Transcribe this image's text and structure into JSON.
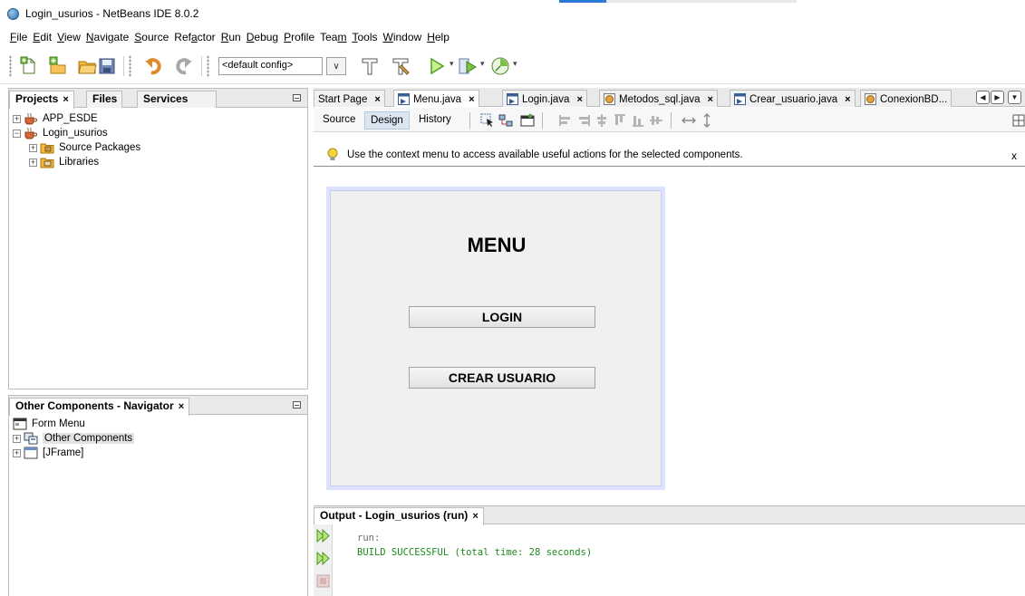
{
  "window": {
    "title": "Login_usurios - NetBeans IDE 8.0.2"
  },
  "menubar": {
    "items": [
      {
        "pre": "",
        "ul": "F",
        "post": "ile"
      },
      {
        "pre": "",
        "ul": "E",
        "post": "dit"
      },
      {
        "pre": "",
        "ul": "V",
        "post": "iew"
      },
      {
        "pre": "",
        "ul": "N",
        "post": "avigate"
      },
      {
        "pre": "",
        "ul": "S",
        "post": "ource"
      },
      {
        "pre": "Ref",
        "ul": "a",
        "post": "ctor"
      },
      {
        "pre": "",
        "ul": "R",
        "post": "un"
      },
      {
        "pre": "",
        "ul": "D",
        "post": "ebug"
      },
      {
        "pre": "",
        "ul": "P",
        "post": "rofile"
      },
      {
        "pre": "Tea",
        "ul": "m",
        "post": ""
      },
      {
        "pre": "",
        "ul": "T",
        "post": "ools"
      },
      {
        "pre": "",
        "ul": "W",
        "post": "indow"
      },
      {
        "pre": "",
        "ul": "H",
        "post": "elp"
      }
    ]
  },
  "toolbar": {
    "config_value": "<default config>",
    "icons": [
      "new-file-icon",
      "new-project-icon",
      "open-project-icon",
      "save-all-icon",
      "undo-icon",
      "redo-icon",
      "clean-build-icon",
      "build-icon",
      "run-icon",
      "debug-icon",
      "profile-icon"
    ]
  },
  "projects_panel": {
    "tabs": [
      "Projects",
      "Files",
      "Services"
    ],
    "close_glyph": "×",
    "tree": [
      {
        "label": "APP_ESDE",
        "expander": "+",
        "level": 0,
        "icon": "coffee-cup-icon"
      },
      {
        "label": "Login_usurios",
        "expander": "−",
        "level": 0,
        "icon": "coffee-cup-icon"
      },
      {
        "label": "Source Packages",
        "expander": "+",
        "level": 1,
        "icon": "package-folder-icon"
      },
      {
        "label": "Libraries",
        "expander": "+",
        "level": 1,
        "icon": "library-folder-icon"
      }
    ]
  },
  "navigator_panel": {
    "tab": "Other Components - Navigator",
    "close_glyph": "×",
    "tree": [
      {
        "label": "Form Menu",
        "expander": "",
        "level": 0,
        "icon": "form-icon"
      },
      {
        "label": "Other Components",
        "expander": "+",
        "level": 0,
        "icon": "components-icon"
      },
      {
        "label": "[JFrame]",
        "expander": "+",
        "level": 0,
        "icon": "frame-icon"
      }
    ]
  },
  "editor": {
    "tabs": [
      {
        "label": "Start Page",
        "icon": "",
        "active": false
      },
      {
        "label": "Menu.java",
        "icon": "form-file-icon",
        "active": true
      },
      {
        "label": "Login.java",
        "icon": "form-file-icon",
        "active": false
      },
      {
        "label": "Metodos_sql.java",
        "icon": "class-file-icon",
        "active": false
      },
      {
        "label": "Crear_usuario.java",
        "icon": "form-file-icon",
        "active": false
      },
      {
        "label": "ConexionBD...",
        "icon": "class-file-icon",
        "active": false
      }
    ],
    "views": [
      "Source",
      "Design",
      "History"
    ],
    "active_view": "Design",
    "hint": "Use the context menu to access available useful actions for the selected components.",
    "hint_close": "x"
  },
  "form": {
    "title": "MENU",
    "buttons": [
      "LOGIN",
      "CREAR USUARIO"
    ]
  },
  "output": {
    "tab": "Output - Login_usurios (run)",
    "close_glyph": "×",
    "line1": "run:",
    "line2": "BUILD SUCCESSFUL (total time: 28 seconds)"
  }
}
